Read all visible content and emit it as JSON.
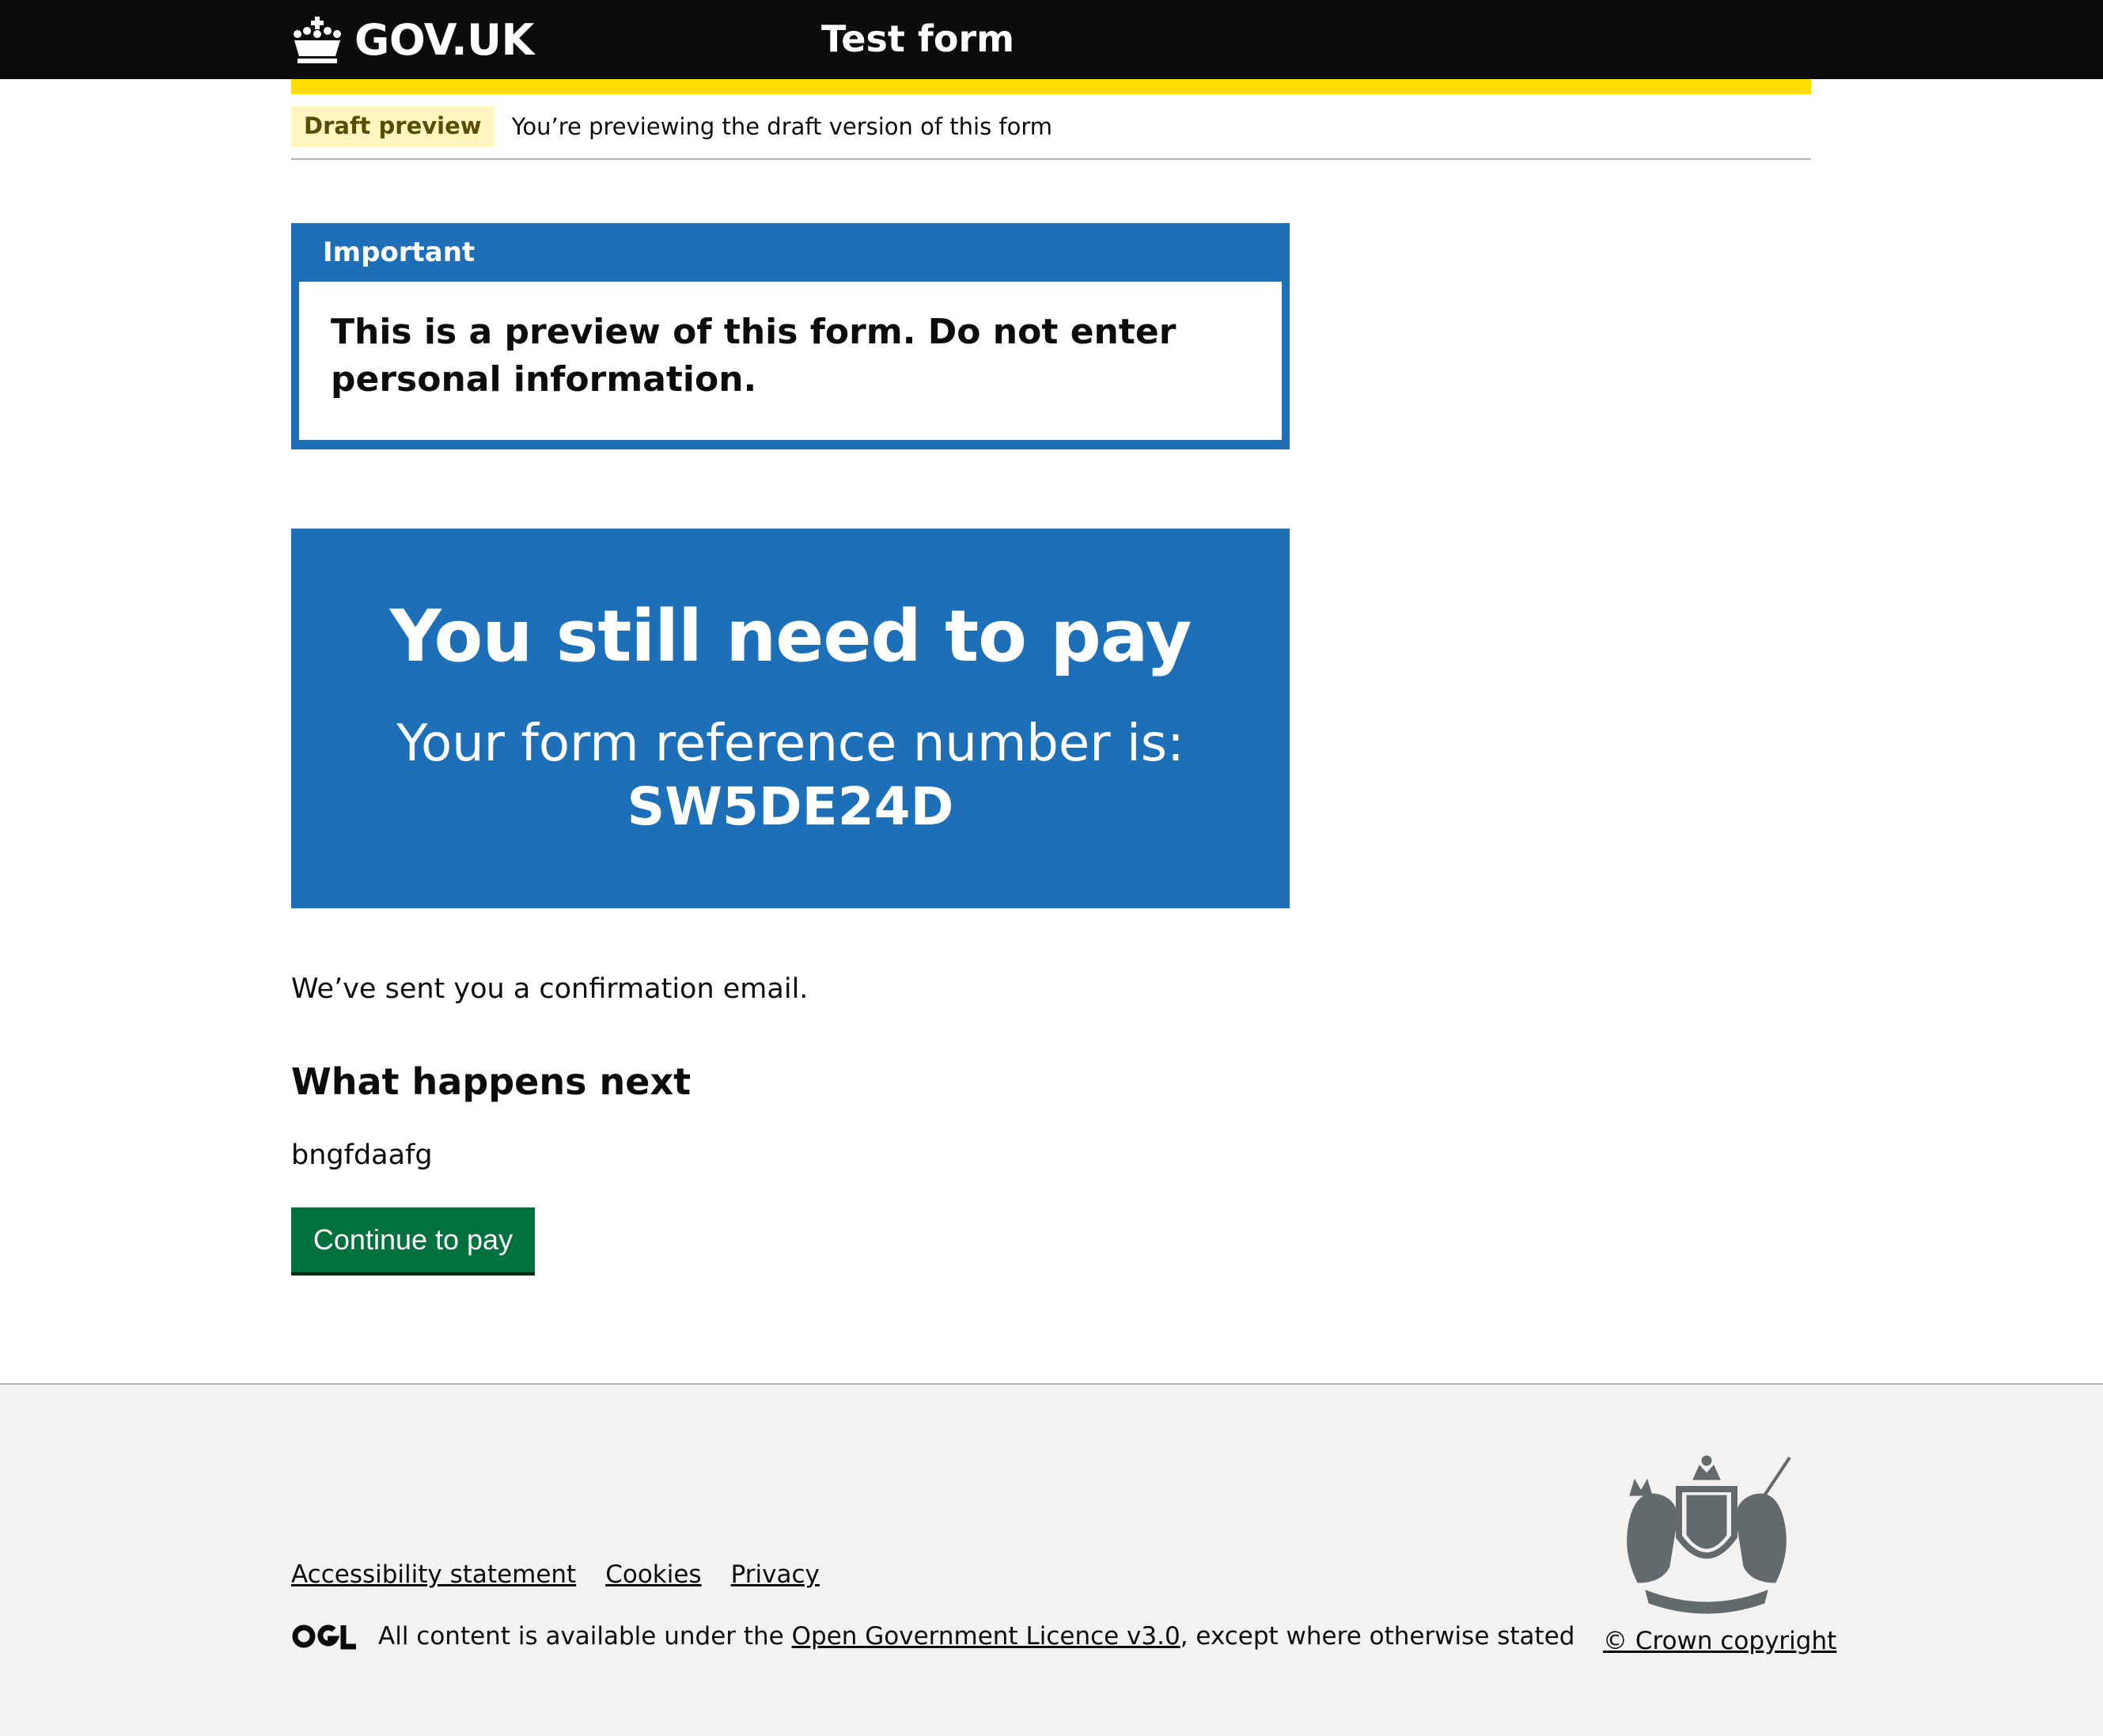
{
  "header": {
    "logo_text": "GOV.UK",
    "service_name": "Test form"
  },
  "phase_banner": {
    "tag": "Draft preview",
    "text": "You’re previewing the draft version of this form"
  },
  "notification": {
    "title": "Important",
    "body": "This is a preview of this form. Do not enter personal information."
  },
  "panel": {
    "title": "You still need to pay",
    "body": "Your form reference number is:",
    "reference": "SW5DE24D"
  },
  "main": {
    "confirmation": "We’ve sent you a confirmation email.",
    "next_heading": "What happens next",
    "next_text": "bngfdaafg",
    "button_label": "Continue to pay"
  },
  "footer": {
    "links": [
      "Accessibility statement",
      "Cookies",
      "Privacy"
    ],
    "licence_prefix": "All content is available under the ",
    "licence_link": "Open Government Licence v3.0",
    "licence_suffix": ", except where otherwise stated",
    "copyright": "© Crown copyright"
  },
  "colors": {
    "header_bg": "#0b0c0c",
    "accent_yellow": "#ffdd00",
    "blue": "#1d70b8",
    "green_button": "#00703c",
    "footer_bg": "#f3f2f1"
  }
}
